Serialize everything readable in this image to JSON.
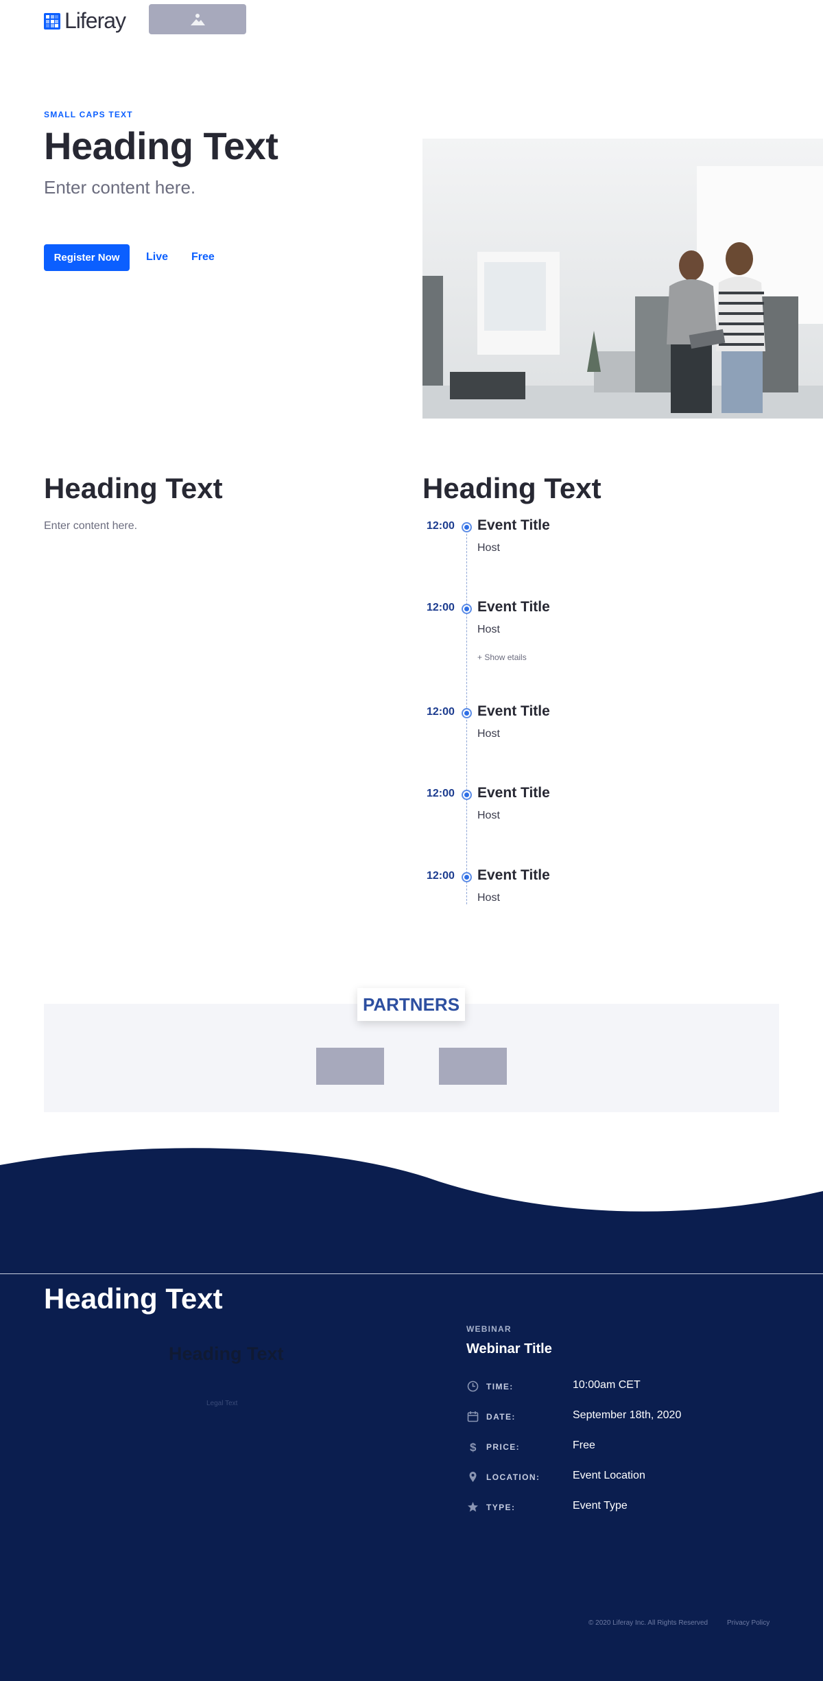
{
  "header": {
    "logo_text": "Liferay",
    "logo_icon": "liferay-logo-icon",
    "image_placeholder_icon": "image-placeholder-icon"
  },
  "hero": {
    "small_caps": "SMALL CAPS TEXT",
    "title": "Heading Text",
    "subtitle": "Enter content here.",
    "register_label": "Register Now",
    "live_label": "Live",
    "free_label": "Free"
  },
  "section2": {
    "left_title": "Heading Text",
    "left_body": "Enter content here.",
    "right_title": "Heading Text"
  },
  "timeline": [
    {
      "time": "12:00",
      "title": "Event Title",
      "host": "Host",
      "more": ""
    },
    {
      "time": "12:00",
      "title": "Event Title",
      "host": "Host",
      "more": "+ Show etails"
    },
    {
      "time": "12:00",
      "title": "Event Title",
      "host": "Host",
      "more": ""
    },
    {
      "time": "12:00",
      "title": "Event Title",
      "host": "Host",
      "more": ""
    },
    {
      "time": "12:00",
      "title": "Event Title",
      "host": "Host",
      "more": ""
    }
  ],
  "partners": {
    "label": "PARTNERS"
  },
  "footer": {
    "title": "Heading Text",
    "ghost_title": "Heading Text",
    "legal": "Legal Text",
    "webinar_kicker": "WEBINAR",
    "webinar_title": "Webinar Title",
    "details": [
      {
        "icon": "clock-icon",
        "label": "TIME:",
        "value": "10:00am CET"
      },
      {
        "icon": "calendar-icon",
        "label": "DATE:",
        "value": "September 18th, 2020"
      },
      {
        "icon": "dollar-icon",
        "label": "PRICE:",
        "value": "Free"
      },
      {
        "icon": "map-pin-icon",
        "label": "LOCATION:",
        "value": "Event Location"
      },
      {
        "icon": "star-icon",
        "label": "TYPE:",
        "value": "Event Type"
      }
    ],
    "copyright": "© 2020 Liferay Inc. All Rights Reserved",
    "privacy": "Privacy Policy"
  },
  "colors": {
    "primary": "#0b5fff",
    "footer_bg": "#0b1e4f",
    "partners_bg": "#f4f5f9",
    "placeholder": "#a7a9bc"
  }
}
